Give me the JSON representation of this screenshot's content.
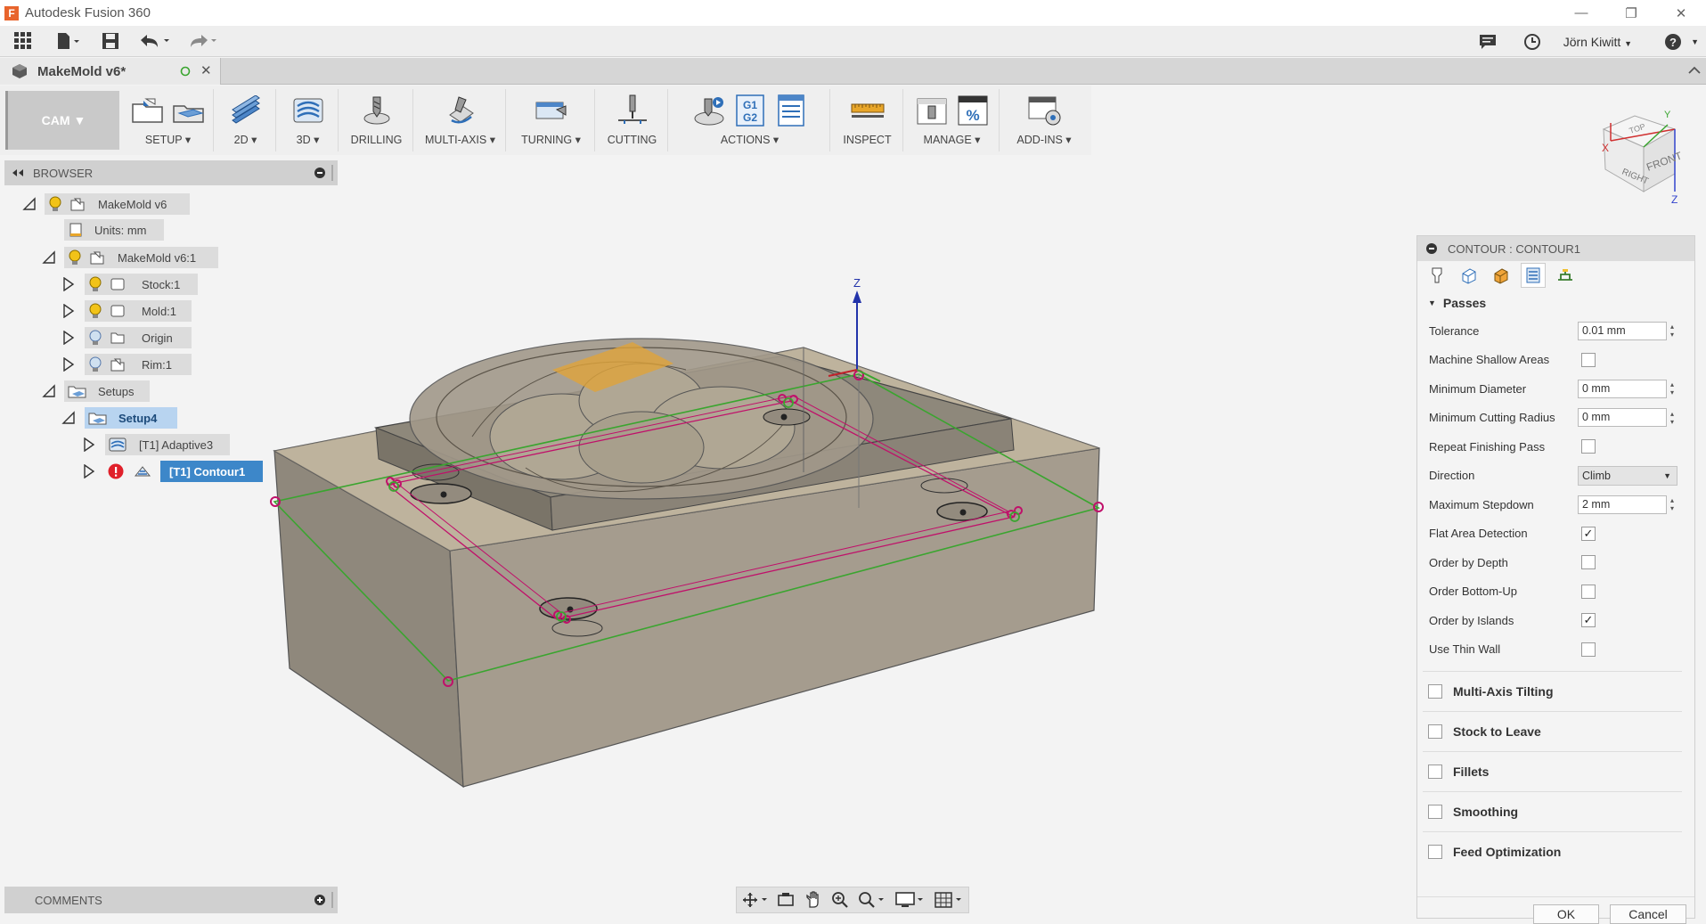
{
  "app": {
    "title": "Autodesk Fusion 360",
    "logo_letter": "F"
  },
  "window": {
    "minimize": "—",
    "restore": "❐",
    "close": "✕"
  },
  "qat": {
    "user_name": "Jörn Kiwitt",
    "user_caret": "▼",
    "help_caret": "▼"
  },
  "document": {
    "tab_title": "MakeMold v6*",
    "close_glyph": "✕"
  },
  "ribbon": {
    "workspace": "CAM ▼",
    "groups": [
      {
        "label": "SETUP ▾"
      },
      {
        "label": "2D ▾"
      },
      {
        "label": "3D ▾"
      },
      {
        "label": "DRILLING"
      },
      {
        "label": "MULTI-AXIS ▾"
      },
      {
        "label": "TURNING ▾"
      },
      {
        "label": "CUTTING"
      },
      {
        "label": "ACTIONS ▾"
      },
      {
        "label": "INSPECT"
      },
      {
        "label": "MANAGE ▾"
      },
      {
        "label": "ADD-INS ▾"
      }
    ],
    "gcode_icon": "G1\nG2",
    "percent_icon": "%"
  },
  "browser": {
    "title": "BROWSER",
    "nodes": {
      "root": "MakeMold v6",
      "units": "Units: mm",
      "component": "MakeMold v6:1",
      "stock": "Stock:1",
      "mold": "Mold:1",
      "origin": "Origin",
      "rim": "Rim:1",
      "setups": "Setups",
      "setup4": "Setup4",
      "adaptive": "[T1] Adaptive3",
      "contour": "[T1] Contour1"
    },
    "warning_glyph": "!"
  },
  "viewport": {
    "axis_label": "Z"
  },
  "viewcube": {
    "front_label": "FRONT",
    "top_label": "TOP",
    "right_label": "RIGHT",
    "axis_y": "Y",
    "axis_z": "Z",
    "axis_x": "X"
  },
  "panel": {
    "title": "CONTOUR : CONTOUR1",
    "section": "Passes",
    "fields": {
      "tolerance_label": "Tolerance",
      "tolerance_value": "0.01 mm",
      "machine_shallow_label": "Machine Shallow Areas",
      "min_diameter_label": "Minimum Diameter",
      "min_diameter_value": "0 mm",
      "min_cutting_radius_label": "Minimum Cutting Radius",
      "min_cutting_radius_value": "0 mm",
      "repeat_finishing_label": "Repeat Finishing Pass",
      "direction_label": "Direction",
      "direction_value": "Climb",
      "max_stepdown_label": "Maximum Stepdown",
      "max_stepdown_value": "2 mm",
      "flat_area_label": "Flat Area Detection",
      "order_depth_label": "Order by Depth",
      "order_bottom_label": "Order Bottom-Up",
      "order_islands_label": "Order by Islands",
      "thin_wall_label": "Use Thin Wall"
    },
    "checked_glyph": "✓",
    "collapsibles": {
      "multi_axis": "Multi-Axis Tilting",
      "stock_to_leave": "Stock to Leave",
      "fillets": "Fillets",
      "smoothing": "Smoothing",
      "feed_optimization": "Feed Optimization"
    },
    "ok_label": "OK",
    "cancel_label": "Cancel"
  },
  "comments": {
    "title": "COMMENTS"
  },
  "colors": {
    "selection": "#3d87c9",
    "accent_magenta": "#c0106a",
    "path_green": "#3aa52f",
    "error_red": "#e0202a"
  }
}
